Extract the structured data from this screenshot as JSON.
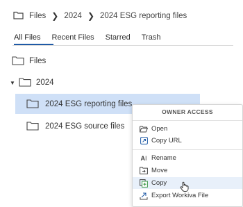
{
  "breadcrumb": {
    "items": [
      "Files",
      "2024",
      "2024 ESG reporting files"
    ],
    "separator": ">"
  },
  "tabs": [
    {
      "label": "All Files",
      "active": true
    },
    {
      "label": "Recent Files",
      "active": false
    },
    {
      "label": "Starred",
      "active": false
    },
    {
      "label": "Trash",
      "active": false
    }
  ],
  "tree": {
    "root": "Files",
    "folder_2024": "2024",
    "children": [
      "2024 ESG reporting files",
      "2024 ESG source files"
    ]
  },
  "context_menu": {
    "header": "OWNER ACCESS",
    "items": [
      {
        "label": "Open",
        "icon": "folder-open-icon"
      },
      {
        "label": "Copy URL",
        "icon": "link-icon"
      },
      {
        "label": "Rename",
        "icon": "rename-icon"
      },
      {
        "label": "Move",
        "icon": "move-icon"
      },
      {
        "label": "Copy",
        "icon": "copy-icon"
      },
      {
        "label": "Export Workiva File",
        "icon": "export-icon"
      }
    ]
  },
  "colors": {
    "accent": "#1f5aa6",
    "selection": "#cfe0f7",
    "menu_hover": "#e8f0fa",
    "copy_icon_green": "#3c9a4a"
  }
}
